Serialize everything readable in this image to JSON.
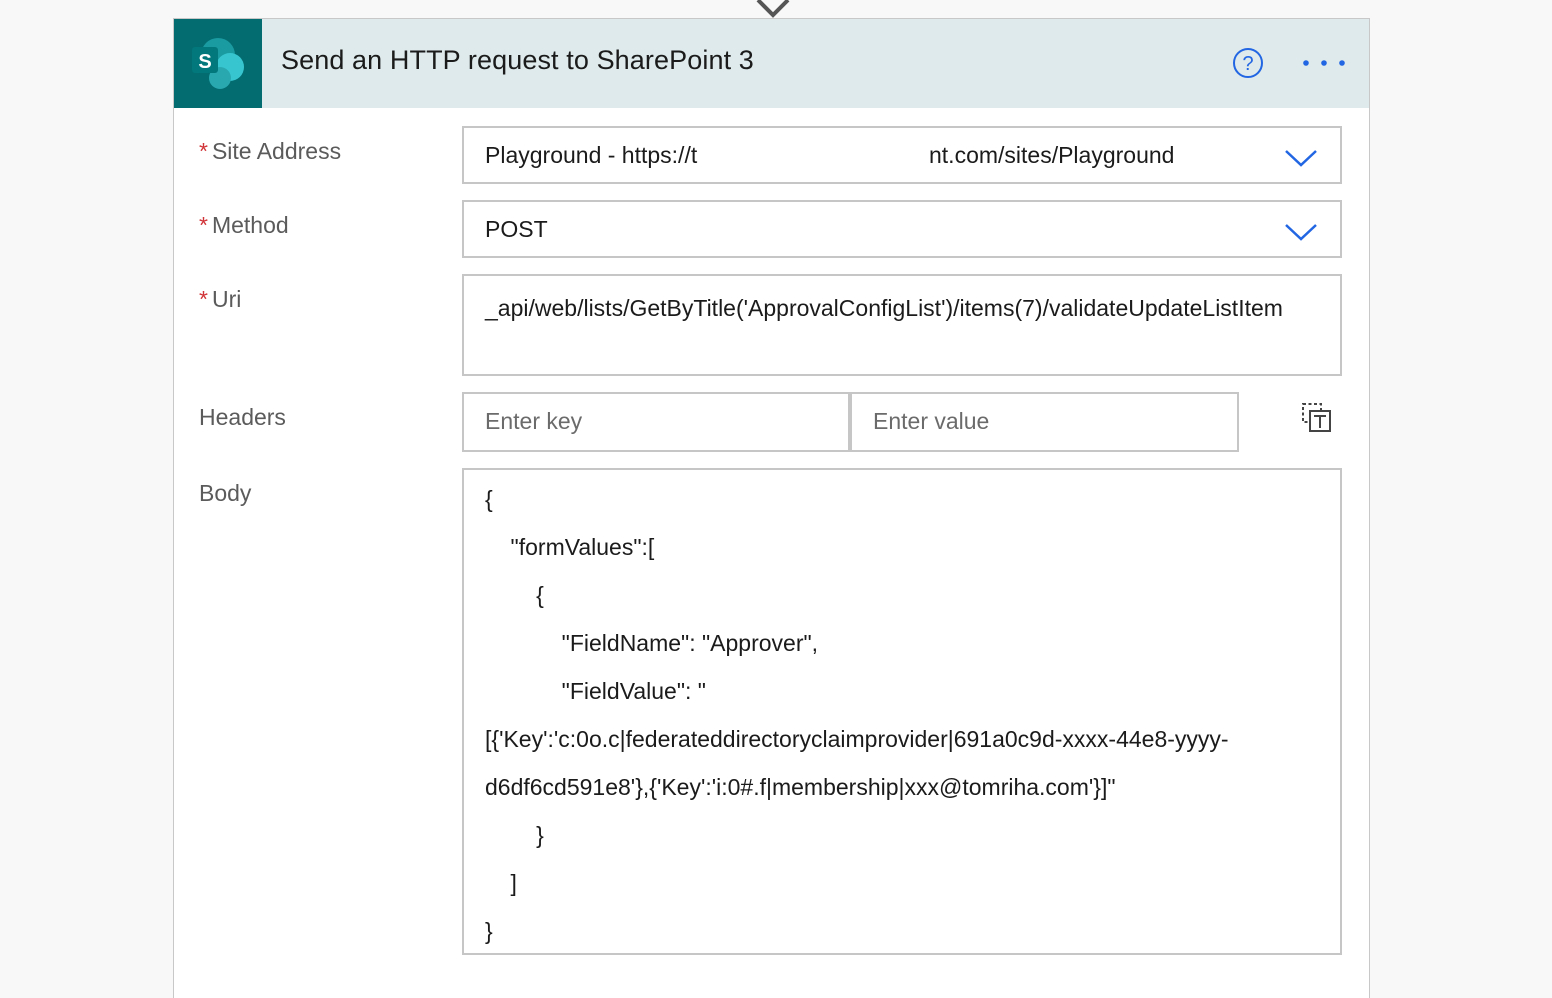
{
  "card": {
    "title": "Send an HTTP request to SharePoint 3",
    "logo_letter": "S",
    "icons": {
      "logo": "sharepoint-logo-icon",
      "help": "help-icon",
      "more": "more-options-icon",
      "connector": "connector-arrow-icon"
    }
  },
  "fields": {
    "site_address": {
      "label": "Site Address",
      "required_mark": "*",
      "value_part1": "Playground - https://t",
      "value_part2": "nt.com/sites/Playground"
    },
    "method": {
      "label": "Method",
      "required_mark": "*",
      "value": "POST"
    },
    "uri": {
      "label": "Uri",
      "required_mark": "*",
      "value": "_api/web/lists/GetByTitle('ApprovalConfigList')/items(7)/validateUpdateListItem"
    },
    "headers": {
      "label": "Headers",
      "key_placeholder": "Enter key",
      "value_placeholder": "Enter value",
      "switch_icon": "switch-to-text-mode-icon"
    },
    "body": {
      "label": "Body",
      "lines": [
        "{",
        "    \"formValues\":[",
        "        {",
        "            \"FieldName\": \"Approver\",",
        "            \"FieldValue\": \"",
        "[{'Key':'c:0o.c|federateddirectoryclaimprovider|691a0c9d-xxxx-44e8-yyyy-",
        "d6df6cd591e8'},{'Key':'i:0#.f|membership|xxx@tomriha.com'}]\"",
        "        }",
        "    ]",
        "}"
      ]
    }
  },
  "colors": {
    "header_bg": "#deeaeb",
    "logo_bg": "#036c70",
    "accent_blue": "#2266e3",
    "required_red": "#d13438"
  }
}
